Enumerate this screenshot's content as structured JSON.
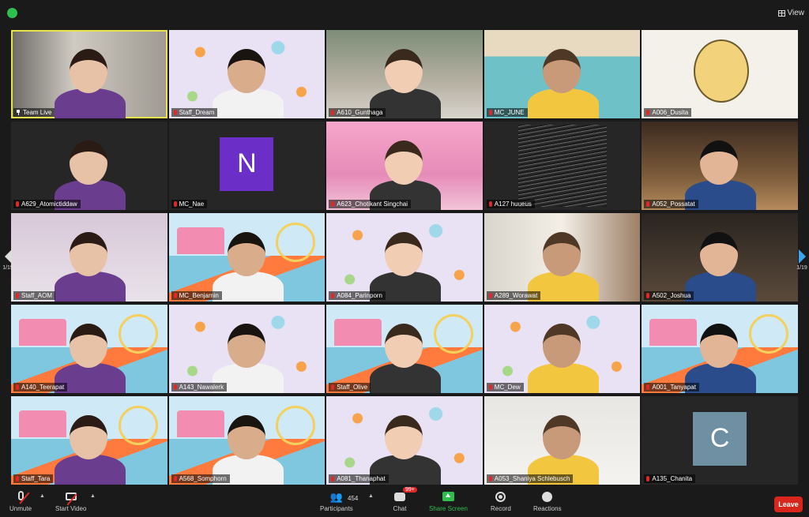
{
  "topbar": {
    "view_label": "View"
  },
  "paging": {
    "left": "1/19",
    "right": "1/19"
  },
  "participants": [
    {
      "name": "Team Live",
      "bg": "room1",
      "pinned": true,
      "active": true
    },
    {
      "name": "Staff_Dream",
      "bg": "pattern"
    },
    {
      "name": "A610_Gunthaga",
      "bg": "outdoor"
    },
    {
      "name": "MC_JUNE",
      "bg": "poster"
    },
    {
      "name": "A006_Dusita",
      "bg": "cartoon"
    },
    {
      "name": "A629_Atomictiddaw",
      "bg": "dark"
    },
    {
      "name": "MC_Nae",
      "bg": "dark",
      "avatar": "N",
      "avatar_color": "#6b2fc8"
    },
    {
      "name": "A623_Chotikant Singchai",
      "bg": "pink"
    },
    {
      "name": "A127 huueus",
      "bg": "water"
    },
    {
      "name": "A052_Possatat",
      "bg": "cafe"
    },
    {
      "name": "Staff_AOM",
      "bg": "lilac"
    },
    {
      "name": "MC_Benjamin",
      "bg": "park"
    },
    {
      "name": "A084_Parinporn",
      "bg": "pattern"
    },
    {
      "name": "A289_Worawat",
      "bg": "stairs"
    },
    {
      "name": "A502_Joshua",
      "bg": "night"
    },
    {
      "name": "A140_Teerapat",
      "bg": "park"
    },
    {
      "name": "A143_Nawalerk",
      "bg": "pattern"
    },
    {
      "name": "Staff_Olive",
      "bg": "park"
    },
    {
      "name": "MC_Dew",
      "bg": "pattern"
    },
    {
      "name": "A001_Tanyapat",
      "bg": "park"
    },
    {
      "name": "Staff_Tara",
      "bg": "park"
    },
    {
      "name": "A568_Somphorn",
      "bg": "park"
    },
    {
      "name": "A081_Thanaphat",
      "bg": "pattern"
    },
    {
      "name": "A053_Shaniya Schlebusch",
      "bg": "white"
    },
    {
      "name": "A135_Chanita",
      "bg": "dark",
      "avatar": "C",
      "avatar_color": "#6f8fa3"
    }
  ],
  "toolbar": {
    "unmute": "Unmute",
    "start_video": "Start Video",
    "participants": "Participants",
    "participants_count": "454",
    "chat": "Chat",
    "chat_badge": "99+",
    "share_screen": "Share Screen",
    "record": "Record",
    "reactions": "Reactions",
    "leave": "Leave"
  },
  "colors": {
    "leave": "#d9261c",
    "share": "#2fbf4f",
    "active_speaker": "#e8e34a",
    "mic_off": "#e02828"
  }
}
